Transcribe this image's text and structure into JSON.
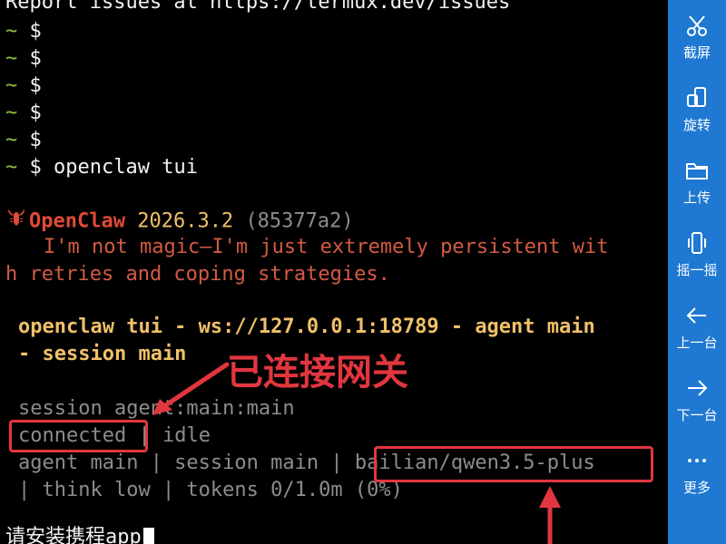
{
  "terminal": {
    "report_line": "Report issues at https://termux.dev/issues",
    "prompt_tilde": "~",
    "prompt_dollar": "$",
    "command": "openclaw tui",
    "banner": {
      "icon": "lobster-icon",
      "name": "OpenClaw",
      "version": "2026.3.2",
      "commit": "(85377a2)",
      "tagline_1": "I'm not magic—I'm just extremely persistent wit",
      "tagline_2": "h retries and coping strategies."
    },
    "header_1": "openclaw tui - ws://127.0.0.1:18789 - agent main",
    "header_2": "- session main",
    "session_line": "session agent:main:main",
    "status_connected": "connected",
    "status_sep": " | ",
    "status_idle": "idle",
    "agent_info": "agent main | session main | ",
    "model": "bailian/qwen3.5-plus",
    "think_line": "| think low | tokens 0/1.0m (0%)",
    "input_text": "请安装携程app"
  },
  "annotations": {
    "gateway_label": "已连接网关"
  },
  "sidebar": {
    "items": [
      {
        "icon": "scissors-icon",
        "label": "截屏"
      },
      {
        "icon": "rotate-icon",
        "label": "旋转"
      },
      {
        "icon": "folder-icon",
        "label": "上传"
      },
      {
        "icon": "phone-shake-icon",
        "label": "摇一摇"
      },
      {
        "icon": "arrow-left-icon",
        "label": "上一台"
      },
      {
        "icon": "arrow-right-icon",
        "label": "下一台"
      },
      {
        "icon": "more-icon",
        "label": "更多"
      }
    ]
  },
  "colors": {
    "accent_red": "#e2363f",
    "sidebar_blue": "#1f78d1",
    "prompt_green": "#8fbf3f",
    "header_yellow": "#f0c069"
  }
}
